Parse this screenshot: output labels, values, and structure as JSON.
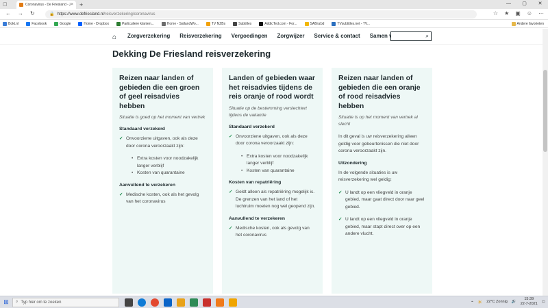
{
  "browser": {
    "tab_title": "Coronavirus - De Friesland - Zorg",
    "tab_close": "×",
    "new_tab": "+",
    "url_domain": "https://www.defriesland.nl",
    "url_path": "/reisverzekering/coronavirus",
    "bookmarks": [
      {
        "label": "Bokt.nl",
        "color": "#3b7dd8"
      },
      {
        "label": "Facebook",
        "color": "#1877f2"
      },
      {
        "label": "Google",
        "color": "#34a853"
      },
      {
        "label": "Home - Dropbox",
        "color": "#0061fe"
      },
      {
        "label": "Particuliere klanten...",
        "color": "#2e7d32"
      },
      {
        "label": "Home - SallandWo...",
        "color": "#6d6d6d"
      },
      {
        "label": "TV NZBs",
        "color": "#f2a20c"
      },
      {
        "label": "Subtitles",
        "color": "#444444"
      },
      {
        "label": "AddicTed.com - For...",
        "color": "#111111"
      },
      {
        "label": "SABnzbd",
        "color": "#f2b705"
      },
      {
        "label": "TVsubtitles.net - TV...",
        "color": "#2a6fbf"
      }
    ],
    "bookmarks_other": "Andere favorieten"
  },
  "site_nav": {
    "links": [
      "Zorgverzekering",
      "Reisverzekering",
      "Vergoedingen",
      "Zorgwijzer",
      "Service & contact",
      "Samen vitaal"
    ]
  },
  "page": {
    "heading": "Dekking De Friesland reisverzekering",
    "cards": [
      {
        "title": "Reizen naar landen of gebieden die een groen of geel reisadvies hebben",
        "subtitle": "Situatie is goed op het moment van vertrek",
        "section1": "Standaard verzekerd",
        "check1": "Onvoorziene uitgaven, ook als deze door corona veroorzaakt zijn:",
        "bullets": [
          "Extra kosten voor noodzakelijk langer verblijf",
          "Kosten van quarantaine"
        ],
        "section2": "Aanvullend te verzekeren",
        "check2": "Medische kosten, ook als het gevolg van het coronavirus"
      },
      {
        "title": "Landen of gebieden waar het reisadvies tijdens de reis oranje of rood wordt",
        "subtitle": "Situatie op de bestemming verslechtert tijdens de vakantie",
        "section1": "Standaard verzekerd",
        "check1": "Onvoorziene uitgaven, ook als deze door corona veroorzaakt zijn:",
        "bullets": [
          "Extra kosten voor noodzakelijk langer verblijf",
          "Kosten van quarantaine"
        ],
        "section2": "Kosten van repatriëring",
        "check2": "Geldt alleen als repatriëring mogelijk is. De grenzen van het land of het luchtruim moeten nog wel geopend zijn.",
        "section3": "Aanvullend te verzekeren",
        "check3": "Medische kosten, ook als gevolg van het coronavirus"
      },
      {
        "title": "Reizen naar landen of gebieden die een oranje of rood reisadvies hebben",
        "subtitle": "Situatie is op het moment van vertrek al slecht",
        "text1": "In dit geval is uw reisverzekering alleen geldig voor gebeurtenissen die niet door corona veroorzaakt zijn.",
        "section1": "Uitzondering",
        "text2": "In de volgende situaties is uw reisverzekering wel geldig:",
        "check1": "U landt op een vliegveld in oranje gebied, maar gaat direct door naar geel gebied.",
        "check2": "U landt op een vliegveld in oranje gebied, maar stapt direct over op een andere vlucht."
      }
    ]
  },
  "taskbar": {
    "search_placeholder": "Typ hier om te zoeken",
    "weather": "22°C  Zonnig",
    "time": "15:39",
    "date": "22-7-2021",
    "apps": [
      "task-view",
      "edge",
      "chrome",
      "outlook",
      "photos",
      "mail",
      "opera",
      "firefox",
      "vlc"
    ],
    "app_colors": [
      "#444444",
      "#0f7bd6",
      "#e3492f",
      "#0a64c8",
      "#e8a21a",
      "#2e8b57",
      "#c9302c",
      "#f07a1a",
      "#f0a500"
    ]
  },
  "colors": {
    "card_bg": "#eef8f6",
    "check_green": "#1b8a4b",
    "text_dark": "#1f2a2e"
  }
}
